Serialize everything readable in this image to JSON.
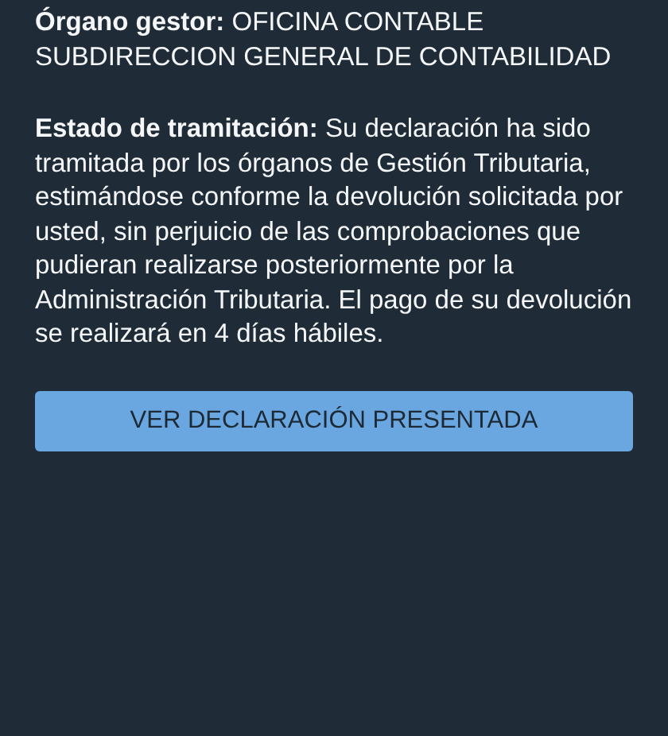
{
  "details": [
    {
      "text": "**Órgano gestor:** OFICINA CONTABLE SUBDIRECCION GENERAL DE CONTABILIDAD"
    },
    {
      "text": "**Estado de tramitación:** Su declaración ha sido tramitada por los órganos de Gestión Tributaria, estimándose conforme la devolución solicitada por usted, sin perjuicio de las comprobaciones que pudieran realizarse posteriormente por la Administración Tributaria. El pago de su devolución se realizará en 4 días hábiles."
    }
  ],
  "button": {
    "label": "VER DECLARACIÓN PRESENTADA"
  }
}
